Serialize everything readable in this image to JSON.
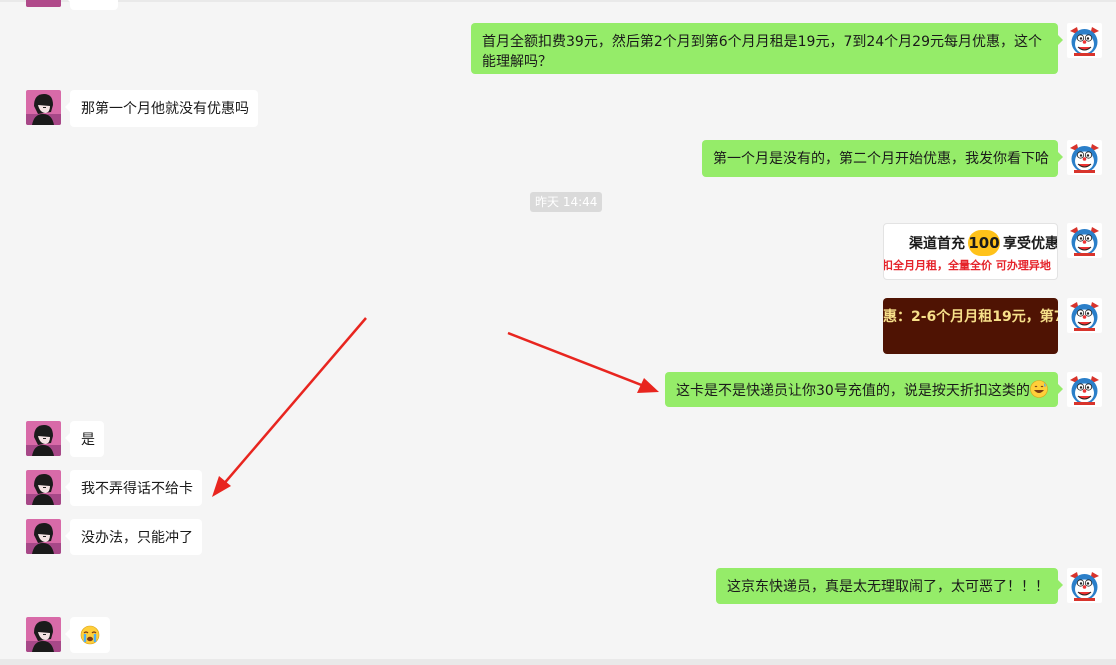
{
  "messages": [
    {
      "id": "m1",
      "side": "out",
      "text": "首月全额扣费39元，然后第2个月到第6个月月租是19元，7到24个月29元每月优惠，这个能理解吗？"
    },
    {
      "id": "m2",
      "side": "in",
      "text": "那第一个月他就没有优惠吗"
    },
    {
      "id": "m3",
      "side": "out",
      "text": "第一个月是没有的，第二个月开始优惠，我发你看下哈"
    },
    {
      "id": "m4",
      "side": "out",
      "type": "image",
      "lines": [
        "渠道首充",
        "100",
        "享受优惠",
        "扣全月月租，全量全价 可办理异地"
      ]
    },
    {
      "id": "m5",
      "side": "out",
      "type": "image",
      "lines": [
        "惠：2-6个月月租19元，第7"
      ]
    },
    {
      "id": "m6",
      "side": "out",
      "text": "这卡是不是快递员让你30号充值的，说是按天折扣这类的"
    },
    {
      "id": "m7",
      "side": "in",
      "text": "是"
    },
    {
      "id": "m8",
      "side": "in",
      "text": "我不弄得话不给卡"
    },
    {
      "id": "m9",
      "side": "in",
      "text": "没办法，只能冲了"
    },
    {
      "id": "m10",
      "side": "out",
      "text": "这京东快递员，真是太无理取闹了，太可恶了！！！"
    },
    {
      "id": "m11",
      "side": "in",
      "type": "emoji",
      "emoji": "crying-face"
    }
  ],
  "timestamp": "昨天 14:44",
  "colors": {
    "background": "#f5f5f5",
    "outgoing_bubble": "#95ec69",
    "incoming_bubble": "#ffffff",
    "timestamp_bg": "#dadada",
    "annotation_arrow": "#e8251f"
  },
  "icons": {
    "contact_avatar": "user-avatar-anime-boy",
    "self_avatar": "user-avatar-cartoon-cat",
    "inline_emoji": "grin-sweat-emoji"
  }
}
